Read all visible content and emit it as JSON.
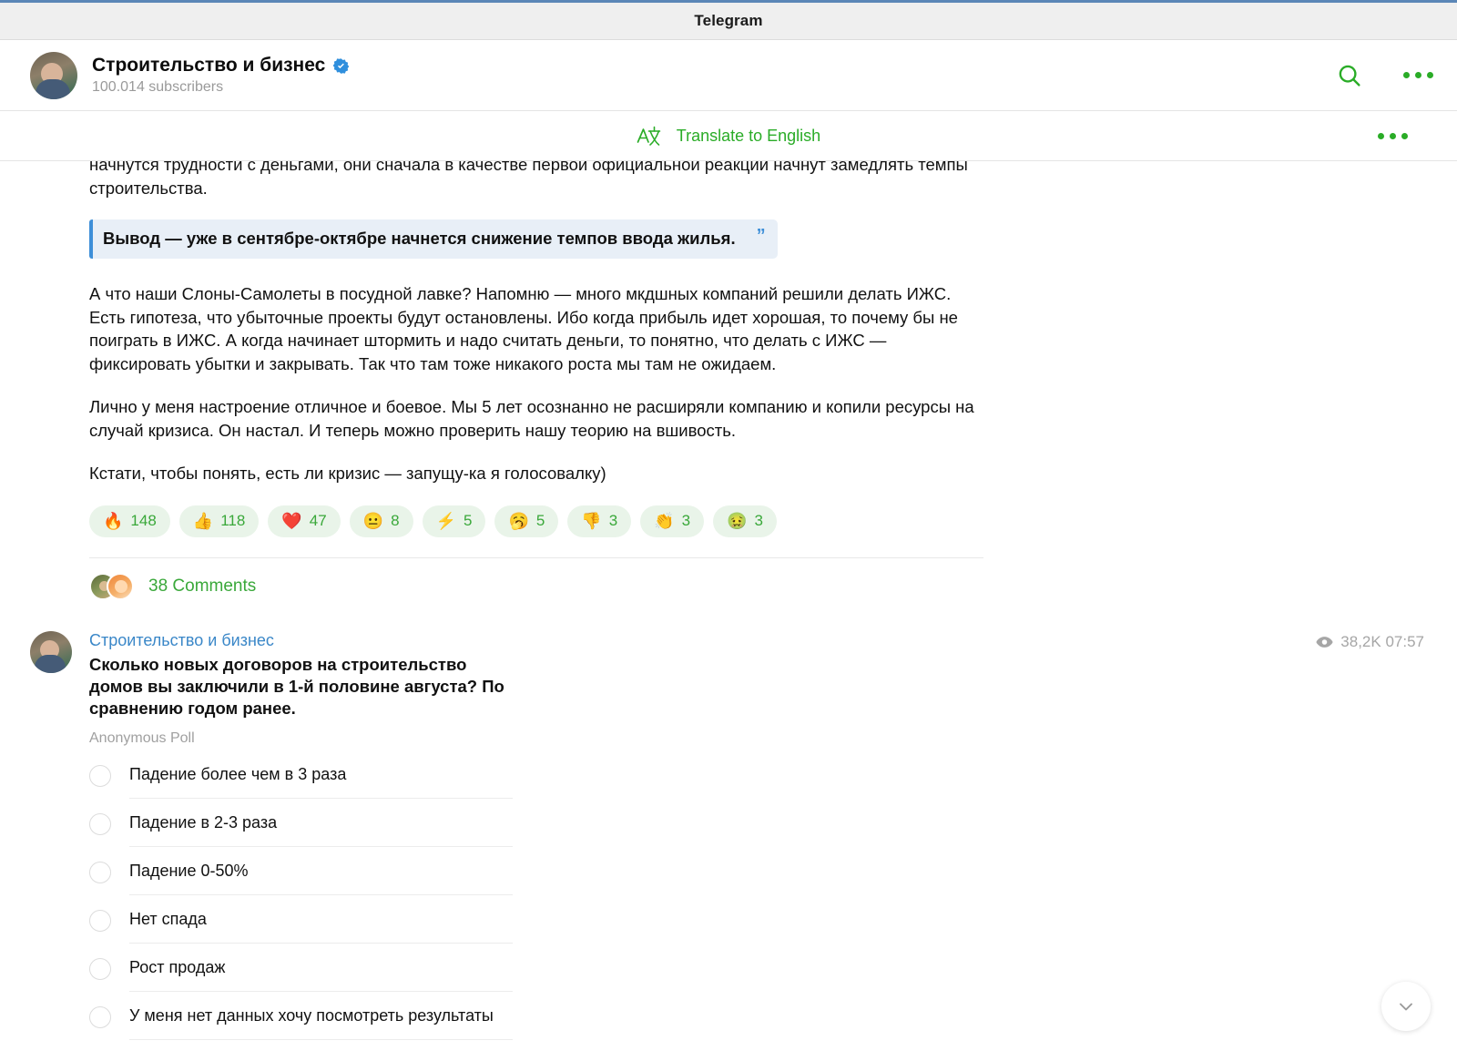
{
  "window": {
    "title": "Telegram"
  },
  "channel": {
    "name": "Строительство и бизнес",
    "subscribers": "100.014 subscribers",
    "verified_icon": "verified-badge-icon",
    "search_icon": "search-icon",
    "menu_icon": "more-options-icon",
    "accent_green": "#2aac27"
  },
  "translate_bar": {
    "icon": "translate-icon",
    "label": "Translate to English",
    "menu_icon": "more-options-icon"
  },
  "post": {
    "paragraph_clipped": "начнутся трудности с деньгами, они сначала в качестве первой официальной реакции начнут замедлять темпы строительства.",
    "quote": {
      "text": "Вывод — уже в сентябре-октябре начнется снижение темпов ввода жилья.",
      "mark": "”",
      "border_color": "#3e8fd8",
      "background": "#e8eff7"
    },
    "paragraphs": [
      "А что наши Слоны-Самолеты в посудной лавке? Напомню — много мкдшных компаний решили делать ИЖС. Есть гипотеза, что убыточные проекты будут остановлены. Ибо когда прибыль идет хорошая, то почему бы не поиграть в ИЖС. А когда начинает штормить и надо считать деньги, то понятно, что делать с ИЖС — фиксировать убытки и закрывать. Так что там тоже никакого роста мы там не ожидаем.",
      "Лично у меня настроение отличное и боевое. Мы 5 лет осознанно не расширяли компанию и копили ресурсы на случай кризиса. Он настал. И теперь можно проверить нашу теорию на вшивость.",
      "Кстати, чтобы понять, есть ли кризис — запущу-ка я голосовалку)"
    ],
    "reactions": [
      {
        "emoji": "🔥",
        "name": "reaction-fire",
        "count": "148"
      },
      {
        "emoji": "👍",
        "name": "reaction-thumbs-up",
        "count": "118"
      },
      {
        "emoji": "❤️",
        "name": "reaction-heart",
        "count": "47"
      },
      {
        "emoji": "😐",
        "name": "reaction-neutral-face",
        "count": "8"
      },
      {
        "emoji": "⚡",
        "name": "reaction-lightning",
        "count": "5"
      },
      {
        "emoji": "🥱",
        "name": "reaction-yawn",
        "count": "5"
      },
      {
        "emoji": "👎",
        "name": "reaction-thumbs-down",
        "count": "3"
      },
      {
        "emoji": "👏",
        "name": "reaction-clap",
        "count": "3"
      },
      {
        "emoji": "🤢",
        "name": "reaction-nauseated",
        "count": "3"
      }
    ],
    "comments_label": "38 Comments"
  },
  "poll": {
    "author": "Строительство и бизнес",
    "question": "Сколько новых договоров на строительство домов вы заключили в 1-й половине августа? По сравнению годом ранее.",
    "type_label": "Anonymous Poll",
    "options": [
      "Падение более чем в 3 раза",
      "Падение в 2-3 раза",
      "Падение 0-50%",
      "Нет спада",
      "Рост продаж",
      "У меня нет данных хочу посмотреть результаты"
    ],
    "views": "38,2K 07:57",
    "views_icon": "eye-icon"
  },
  "scroll_button": {
    "icon": "chevron-down-icon"
  }
}
